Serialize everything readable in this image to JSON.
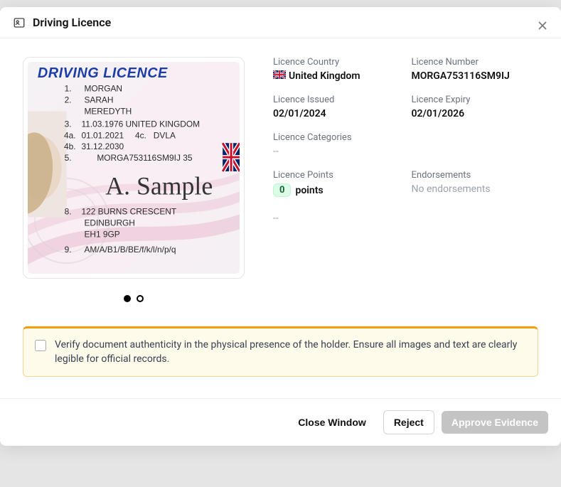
{
  "header": {
    "title": "Driving Licence"
  },
  "licence_card": {
    "title": "DRIVING LICENCE",
    "row1": {
      "num": "1.",
      "val": "MORGAN"
    },
    "row2": {
      "num": "2.",
      "val1": "SARAH",
      "val2": "MEREDYTH"
    },
    "row3": {
      "num": "3.",
      "val": "11.03.1976  UNITED KINGDOM"
    },
    "row4a": {
      "num": "4a.",
      "date": "01.01.2021",
      "sub": "4c.",
      "org": "DVLA"
    },
    "row4b": {
      "num": "4b.",
      "val": "31.12.2030"
    },
    "row5": {
      "num": "5.",
      "val": "MORGA753116SM9IJ  35"
    },
    "signature": "A. Sample",
    "row8": {
      "num": "8.",
      "line1": "122 BURNS CRESCENT",
      "line2": "EDINBURGH",
      "line3": "EH1 9GP"
    },
    "row9": {
      "num": "9.",
      "val": "AM/A/B1/B/BE/f/k/l/n/p/q"
    }
  },
  "details": {
    "country_label": "Licence Country",
    "country_value": "United Kingdom",
    "number_label": "Licence Number",
    "number_value": "MORGA753116SM9IJ",
    "issued_label": "Licence Issued",
    "issued_value": "02/01/2024",
    "expiry_label": "Licence Expiry",
    "expiry_value": "02/01/2026",
    "categories_label": "Licence Categories",
    "categories_value": "--",
    "points_label": "Licence Points",
    "points_badge": "0",
    "points_suffix": "points",
    "points_extra": "--",
    "endorsements_label": "Endorsements",
    "endorsements_value": "No endorsements"
  },
  "callout": {
    "text": "Verify document authenticity in the physical presence of the holder. Ensure all images and text are clearly legible for official records."
  },
  "footer": {
    "close": "Close Window",
    "reject": "Reject",
    "approve": "Approve Evidence"
  }
}
